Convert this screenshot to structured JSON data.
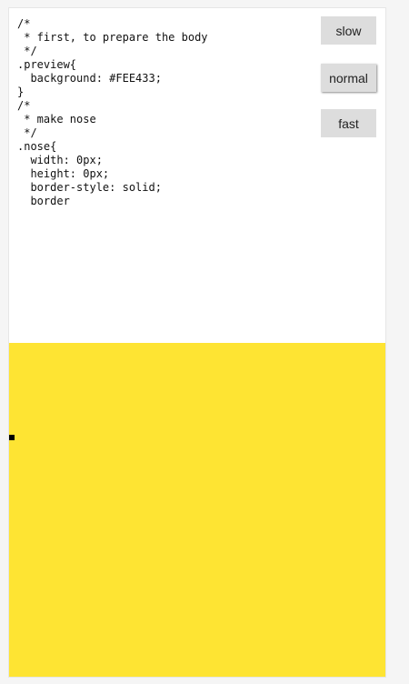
{
  "editor": {
    "code": "/*\n * first, to prepare the body\n */\n.preview{\n  background: #FEE433;\n}\n/*\n * make nose\n */\n.nose{\n  width: 0px;\n  height: 0px;\n  border-style: solid;\n  border"
  },
  "controls": {
    "slow_label": "slow",
    "normal_label": "normal",
    "fast_label": "fast",
    "selected": "normal"
  },
  "preview": {
    "background": "#FEE433",
    "nose_color": "#000000"
  }
}
